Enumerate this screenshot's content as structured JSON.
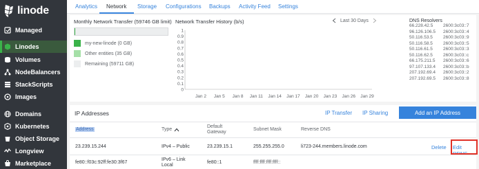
{
  "brand": {
    "name": "linode",
    "accent": "#3bb34a",
    "link": "#3683dc",
    "sidebar_bg": "#32363c",
    "highlight": "#e03127"
  },
  "sidebar": {
    "items": [
      {
        "label": "Managed",
        "icon": "managed-icon",
        "active": false
      },
      {
        "label": "Linodes",
        "icon": "linodes-icon",
        "active": true
      },
      {
        "label": "Volumes",
        "icon": "volumes-icon",
        "active": false
      },
      {
        "label": "NodeBalancers",
        "icon": "nodebalancers-icon",
        "active": false
      },
      {
        "label": "StackScripts",
        "icon": "stackscripts-icon",
        "active": false
      },
      {
        "label": "Images",
        "icon": "images-icon",
        "active": false
      },
      {
        "label": "Domains",
        "icon": "domains-icon",
        "active": false
      },
      {
        "label": "Kubernetes",
        "icon": "kubernetes-icon",
        "active": false
      },
      {
        "label": "Object Storage",
        "icon": "object-storage-icon",
        "active": false
      },
      {
        "label": "Longview",
        "icon": "longview-icon",
        "active": false
      },
      {
        "label": "Marketplace",
        "icon": "marketplace-icon",
        "active": false
      }
    ]
  },
  "tabs": [
    {
      "label": "Analytics",
      "active": false
    },
    {
      "label": "Network",
      "active": true
    },
    {
      "label": "Storage",
      "active": false
    },
    {
      "label": "Configurations",
      "active": false
    },
    {
      "label": "Backups",
      "active": false
    },
    {
      "label": "Activity Feed",
      "active": false
    },
    {
      "label": "Settings",
      "active": false
    }
  ],
  "transfer": {
    "title": "Monthly Network Transfer (59746 GB limit)",
    "used_fraction": 0.003,
    "legend": [
      {
        "label": "my-new-linode (0 GB)",
        "color": "#3bb34a"
      },
      {
        "label": "Other entities (35 GB)",
        "color": "#a6e0a8"
      },
      {
        "label": "Remaining (59711 GB)",
        "color": "#eceeef"
      }
    ]
  },
  "history": {
    "title": "Network Transfer History (b/s)",
    "range_label": "Last 30 Days",
    "prev_icon": "chevron-left-icon",
    "next_icon": "chevron-right-icon"
  },
  "chart_data": {
    "type": "line",
    "title": "Network Transfer History (b/s)",
    "x": [
      "Jan 2",
      "Jan 5",
      "Jan 8",
      "Jan 11",
      "Jan 14",
      "Jan 17",
      "Jan 20",
      "Jan 23",
      "Jan 26",
      "Jan 29"
    ],
    "y_ticks": [
      "1",
      "0.9",
      "0.8",
      "0.7",
      "0.6",
      "0.5",
      "0.4",
      "0.3",
      "0.2",
      "0.1",
      "0"
    ],
    "ylim": [
      0,
      1
    ],
    "series": [],
    "grid": false
  },
  "dns": {
    "title": "DNS Resolvers",
    "rows": [
      [
        "66.228.42.5",
        "2600:3c03::7"
      ],
      [
        "96.126.106.5",
        "2600:3c03::4"
      ],
      [
        "50.116.53.5",
        "2600:3c03::9"
      ],
      [
        "50.116.58.5",
        "2600:3c03::5"
      ],
      [
        "50.116.61.5",
        "2600:3c03::3"
      ],
      [
        "50.116.62.5",
        "2600:3c03::c"
      ],
      [
        "66.175.211.5",
        "2600:3c03::6"
      ],
      [
        "97.107.133.4",
        "2600:3c03::b"
      ],
      [
        "207.192.69.4",
        "2600:3c03::2"
      ],
      [
        "207.192.69.5",
        "2600:3c03::8"
      ]
    ]
  },
  "ip": {
    "title": "IP Addresses",
    "transfer_label": "IP Transfer",
    "sharing_label": "IP Sharing",
    "add_label": "Add an IP Address",
    "headers": {
      "address": "Address",
      "type": "Type",
      "type_sort_icon": "sort-up-icon",
      "gateway_l1": "Default",
      "gateway_l2": "Gateway",
      "mask": "Subnet Mask",
      "rdns": "Reverse DNS"
    },
    "rows": [
      {
        "address": "23.239.15.244",
        "type": "IPv4 – Public",
        "gateway": "23.239.15.1",
        "mask": "255.255.255.0",
        "rdns": "li723-244.members.linode.com",
        "delete": "Delete",
        "edit": "Edit RDNS"
      },
      {
        "address": "fe80::f03c:92ff:fe30:3f67",
        "type_l1": "IPv6 – Link",
        "type_l2": "Local",
        "gateway": "fe80::1",
        "mask": "ffff:ffff:ffff:ffff::"
      }
    ]
  }
}
